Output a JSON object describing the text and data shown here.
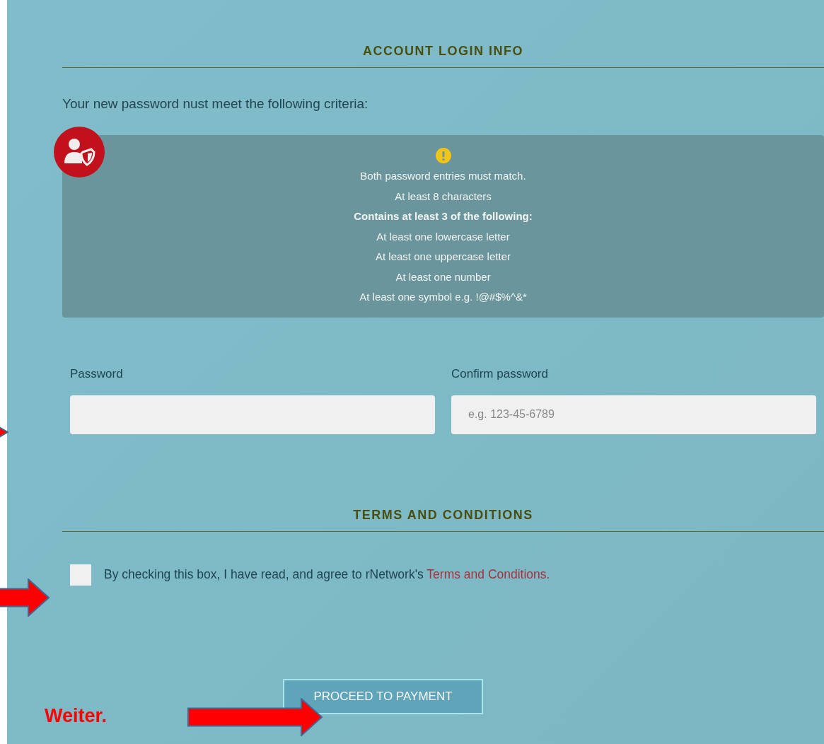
{
  "account_section": {
    "heading": "ACCOUNT LOGIN INFO",
    "intro": "Your new password nust meet the following criteria:",
    "criteria": [
      "Both password entries must match.",
      "At least 8 characters",
      "**Contains at least 3 of the following:**",
      "At least one lowercase letter",
      "At least one uppercase letter",
      "At least one number",
      "At least one symbol e.g. !@#$%^&*"
    ],
    "fields": [
      {
        "label": "Password"
      },
      {
        "label": "Confirm password",
        "placeholder": "e.g. 123-45-6789"
      }
    ]
  },
  "terms_section": {
    "heading": "TERMS AND CONDITIONS",
    "checked": false,
    "agreement": "By checking this box, I have read, and agree to rNetwork's ",
    "link": "Terms and Conditions."
  },
  "proceed_button": "PROCEED TO PAYMENT",
  "annotation": {
    "note": "Weiter."
  }
}
